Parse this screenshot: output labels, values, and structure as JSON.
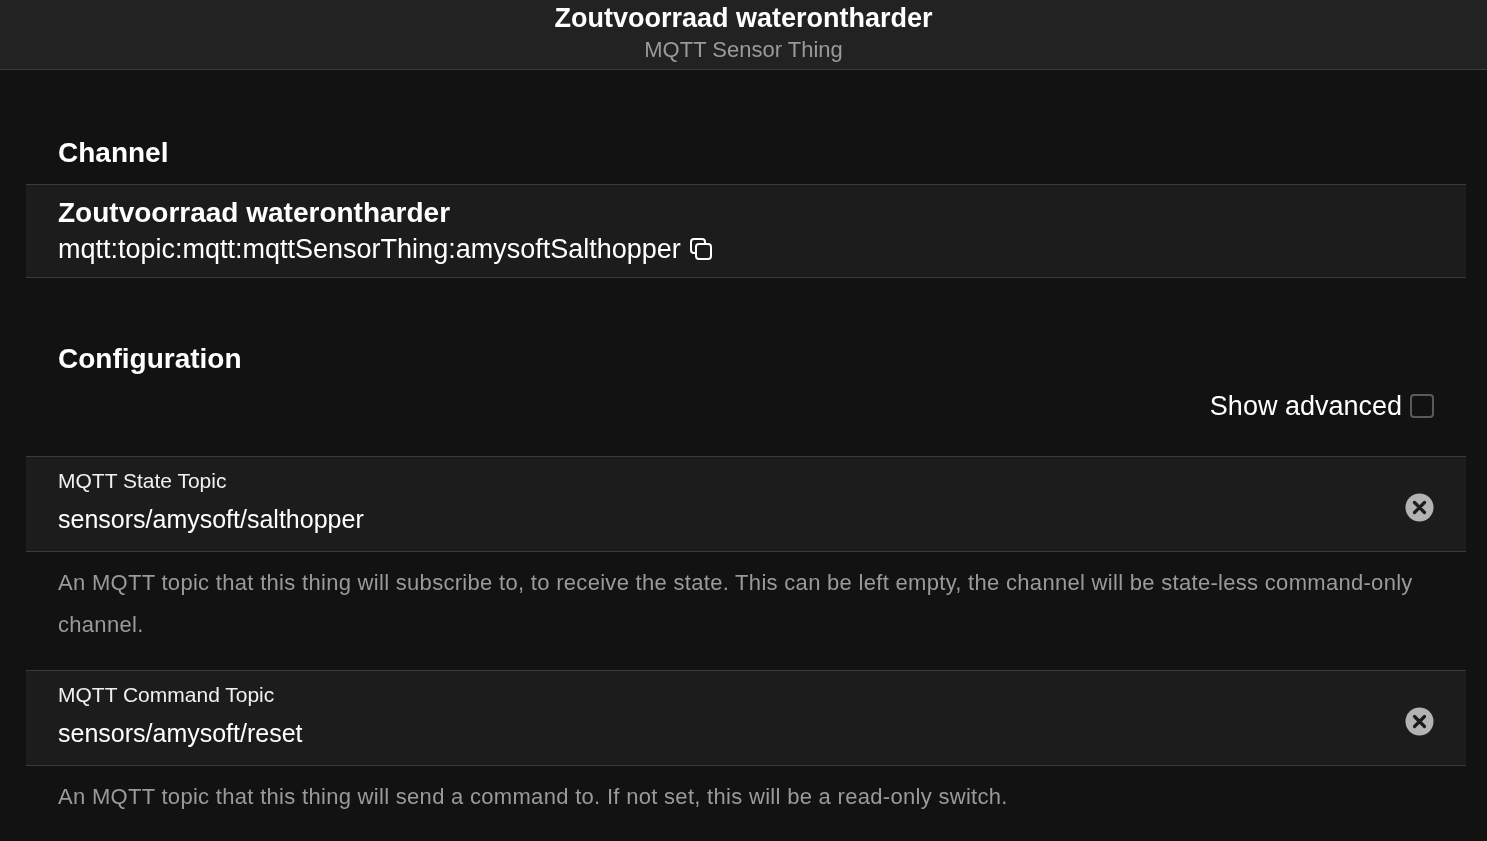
{
  "header": {
    "title": "Zoutvoorraad waterontharder",
    "subtitle": "MQTT Sensor Thing"
  },
  "channel": {
    "heading": "Channel",
    "name": "Zoutvoorraad waterontharder",
    "uid": "mqtt:topic:mqtt:mqttSensorThing:amysoftSalthopper"
  },
  "configuration": {
    "heading": "Configuration",
    "show_advanced": {
      "label": "Show advanced",
      "checked": false
    },
    "fields": [
      {
        "label": "MQTT State Topic",
        "value": "sensors/amysoft/salthopper",
        "description": "An MQTT topic that this thing will subscribe to, to receive the state. This can be left empty, the channel will be state-less command-only channel."
      },
      {
        "label": "MQTT Command Topic",
        "value": "sensors/amysoft/reset",
        "description": "An MQTT topic that this thing will send a command to. If not set, this will be a read-only switch."
      }
    ]
  }
}
